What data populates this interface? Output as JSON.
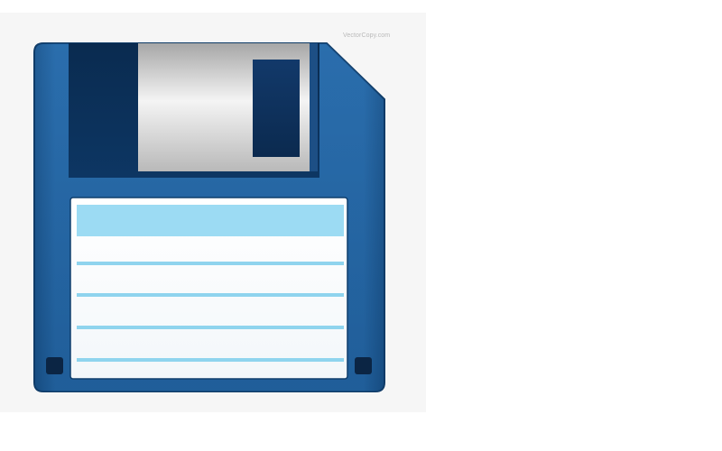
{
  "image": {
    "subject": "floppy-disk-icon",
    "watermark_text": "VectorCopy.com",
    "colors": {
      "panel_background": "#f6f6f6",
      "disk_body_light": "#2a6fae",
      "disk_body_dark": "#134a80",
      "shutter_dark": "#0d2f55",
      "shutter_metal_light": "#f2f2f2",
      "shutter_metal_dark": "#a9a9a9",
      "shutter_window": "#0f3360",
      "label_background": "#ffffff",
      "label_header": "#9cdbf3",
      "label_lines": "#8fd4ee",
      "hole": "#0b2544"
    }
  }
}
